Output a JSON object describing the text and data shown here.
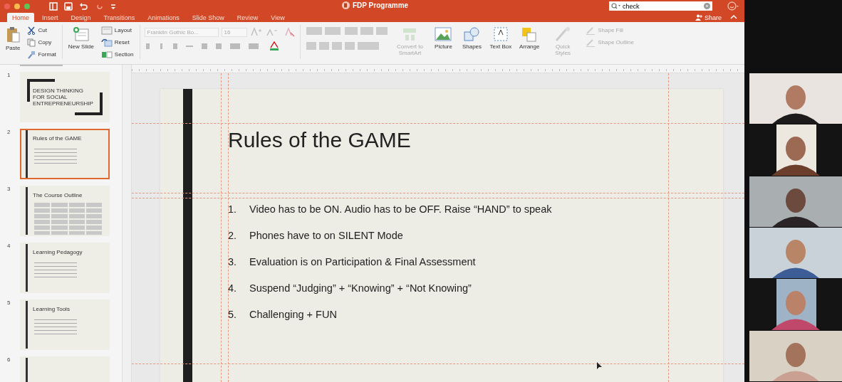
{
  "window": {
    "title": "FDP Programme"
  },
  "search": {
    "value": "check"
  },
  "share": "Share",
  "tabs": [
    {
      "label": "Home",
      "selected": true
    },
    {
      "label": "Insert",
      "selected": false
    },
    {
      "label": "Design",
      "selected": false
    },
    {
      "label": "Transitions",
      "selected": false
    },
    {
      "label": "Animations",
      "selected": false
    },
    {
      "label": "Slide Show",
      "selected": false
    },
    {
      "label": "Review",
      "selected": false
    },
    {
      "label": "View",
      "selected": false
    }
  ],
  "ribbon": {
    "paste": "Paste",
    "clipboard": [
      "Cut",
      "Copy",
      "Format"
    ],
    "new_slide": "New Slide",
    "slide_tools": [
      "Layout",
      "Reset",
      "Section"
    ],
    "font": {
      "name": "Franklin Gothic Bo...",
      "size": "16"
    },
    "tools": [
      {
        "kind": "smartart",
        "label": "Convert to SmartArt",
        "disabled": true
      },
      {
        "kind": "picture",
        "label": "Picture",
        "disabled": false
      },
      {
        "kind": "shapes",
        "label": "Shapes",
        "disabled": false
      },
      {
        "kind": "textbox",
        "label": "Text Box",
        "disabled": false
      },
      {
        "kind": "arrange",
        "label": "Arrange",
        "disabled": false
      },
      {
        "kind": "styles",
        "label": "Quick Styles",
        "disabled": true
      }
    ],
    "shape_tools": [
      {
        "label": "Shape Fill",
        "disabled": true
      },
      {
        "label": "Shape Outline",
        "disabled": true
      }
    ]
  },
  "slides": [
    {
      "number": "1",
      "kind": "title",
      "title": "DESIGN THINKING FOR SOCIAL ENTREPRENEURSHIP",
      "selected": false
    },
    {
      "number": "2",
      "kind": "bullets",
      "title": "Rules of the GAME",
      "selected": true
    },
    {
      "number": "3",
      "kind": "table",
      "title": "The Course Outline",
      "selected": false
    },
    {
      "number": "4",
      "kind": "bullets",
      "title": "Learning Pedagogy",
      "selected": false
    },
    {
      "number": "5",
      "kind": "bullets",
      "title": "Learning Tools",
      "selected": false
    },
    {
      "number": "6",
      "kind": "blank",
      "selected": false
    }
  ],
  "slide": {
    "title": "Rules of the GAME",
    "items": [
      {
        "number": "1.",
        "text": "Video has to be ON. Audio has to be OFF. Raise “HAND” to speak"
      },
      {
        "number": "2.",
        "text": "Phones have to on SILENT Mode"
      },
      {
        "number": "3.",
        "text": "Evaluation is on Participation & Final Assessment"
      },
      {
        "number": "4.",
        "text": "Suspend “Judging” + “Knowing” + “Not Knowing”"
      },
      {
        "number": "5.",
        "text": "Challenging + FUN"
      }
    ]
  }
}
